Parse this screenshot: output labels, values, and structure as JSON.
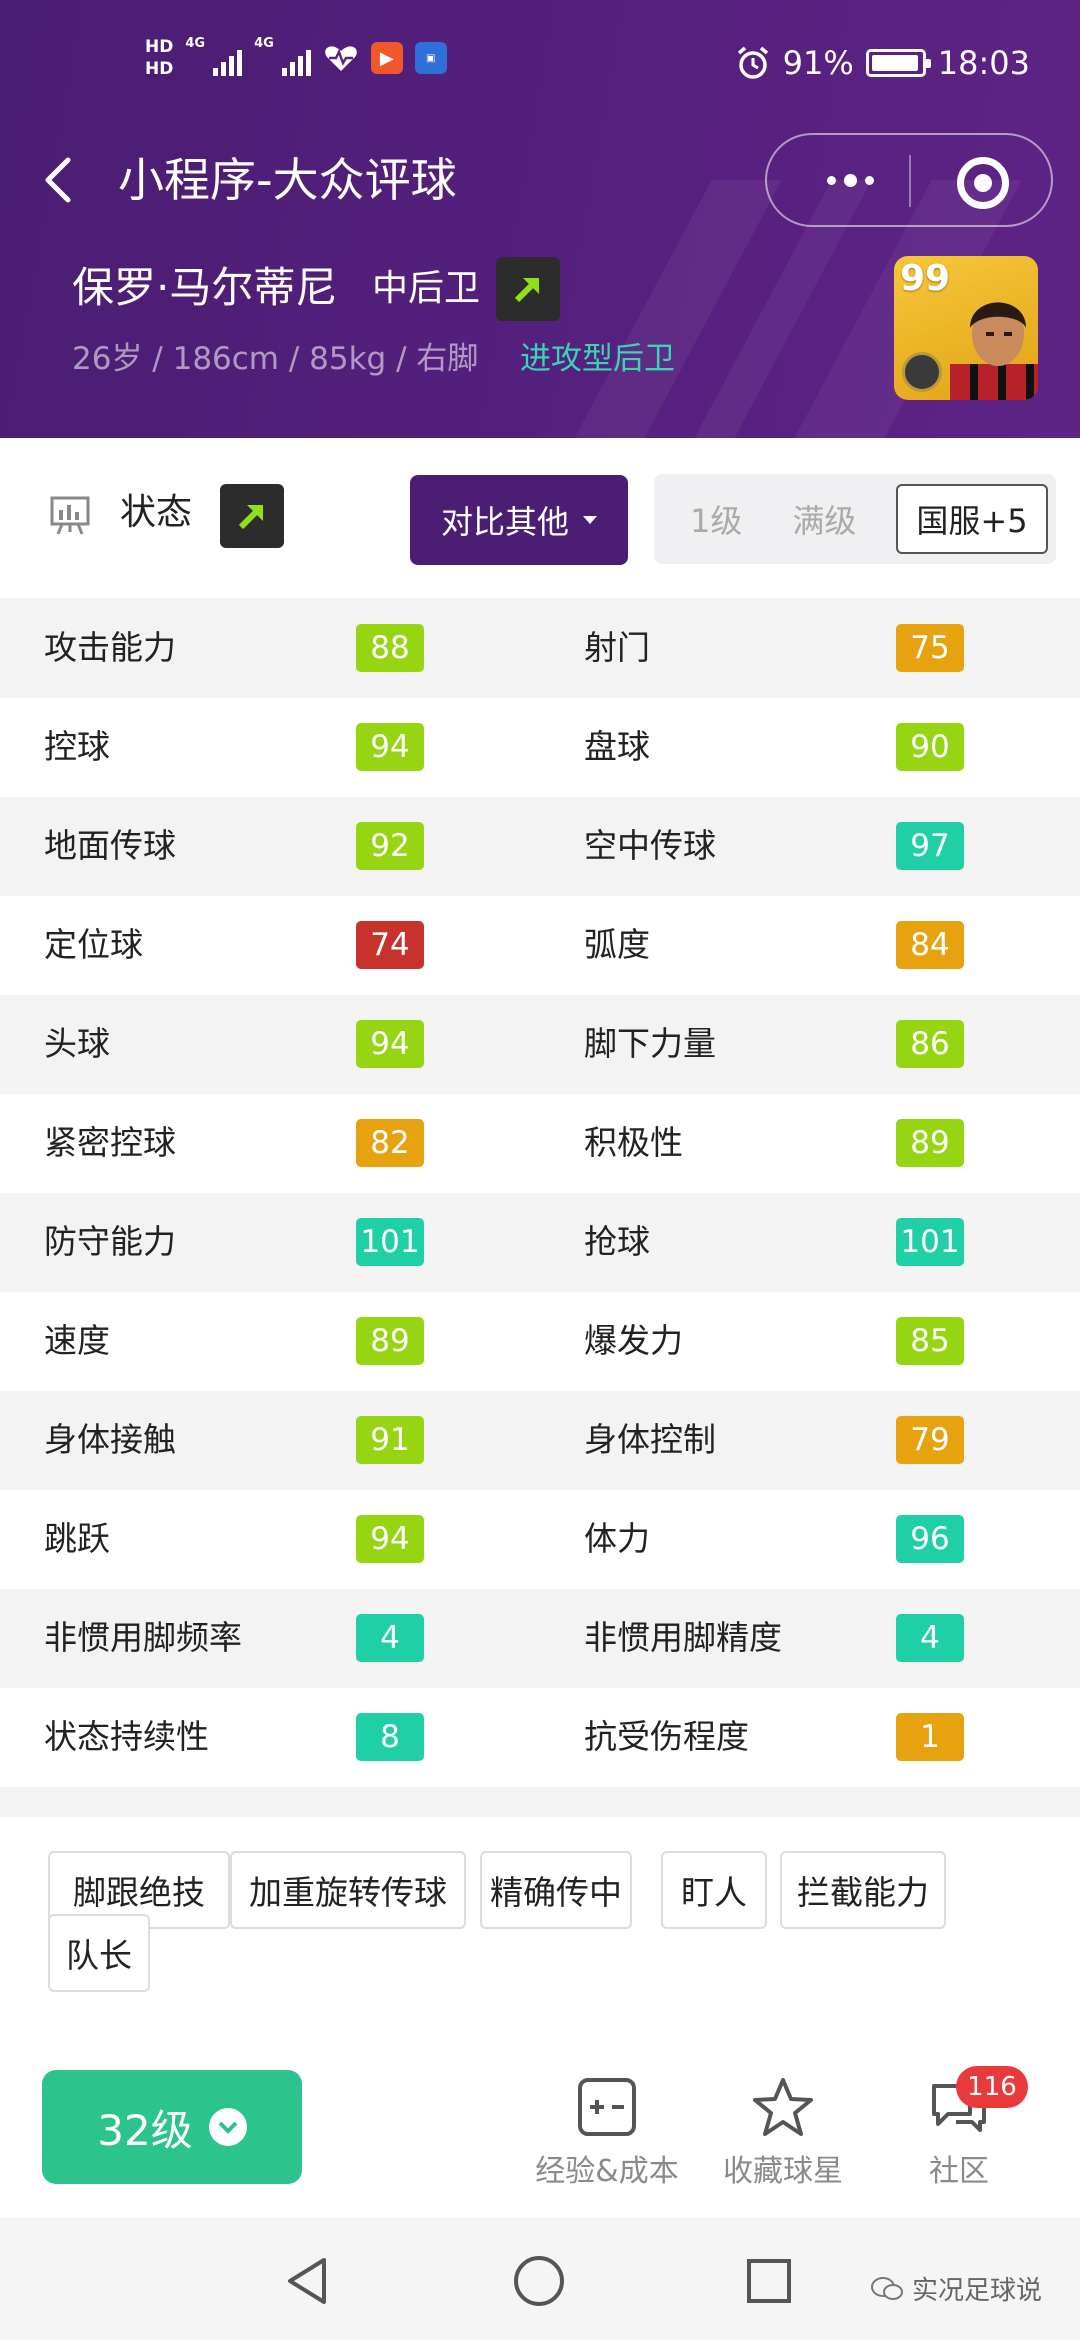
{
  "status_bar": {
    "hd1": "HD",
    "hd2": "HD",
    "net1": "4G",
    "net2": "4G",
    "battery_percent": "91%",
    "time": "18:03"
  },
  "nav": {
    "title": "小程序-大众评球"
  },
  "player": {
    "name": "保罗·马尔蒂尼",
    "position": "中后卫",
    "info": "26岁 / 186cm / 85kg / 右脚",
    "style": "进攻型后卫",
    "rating": "99"
  },
  "tab": {
    "label": "状态",
    "compare_label": "对比其他",
    "levels": [
      "1级",
      "满级"
    ],
    "active_level": "国服+5"
  },
  "stats": [
    {
      "left": {
        "name": "攻击能力",
        "value": "88",
        "color": "#95d512"
      },
      "right": {
        "name": "射门",
        "value": "75",
        "color": "#e7a20f"
      }
    },
    {
      "left": {
        "name": "控球",
        "value": "94",
        "color": "#95d512"
      },
      "right": {
        "name": "盘球",
        "value": "90",
        "color": "#95d512"
      }
    },
    {
      "left": {
        "name": "地面传球",
        "value": "92",
        "color": "#95d512"
      },
      "right": {
        "name": "空中传球",
        "value": "97",
        "color": "#1fcfa6"
      }
    },
    {
      "left": {
        "name": "定位球",
        "value": "74",
        "color": "#c8322c"
      },
      "right": {
        "name": "弧度",
        "value": "84",
        "color": "#e7a20f"
      }
    },
    {
      "left": {
        "name": "头球",
        "value": "94",
        "color": "#95d512"
      },
      "right": {
        "name": "脚下力量",
        "value": "86",
        "color": "#95d512"
      }
    },
    {
      "left": {
        "name": "紧密控球",
        "value": "82",
        "color": "#e7a20f"
      },
      "right": {
        "name": "积极性",
        "value": "89",
        "color": "#95d512"
      }
    },
    {
      "left": {
        "name": "防守能力",
        "value": "101",
        "color": "#1fcfa6"
      },
      "right": {
        "name": "抢球",
        "value": "101",
        "color": "#1fcfa6"
      }
    },
    {
      "left": {
        "name": "速度",
        "value": "89",
        "color": "#95d512"
      },
      "right": {
        "name": "爆发力",
        "value": "85",
        "color": "#95d512"
      }
    },
    {
      "left": {
        "name": "身体接触",
        "value": "91",
        "color": "#95d512"
      },
      "right": {
        "name": "身体控制",
        "value": "79",
        "color": "#e7a20f"
      }
    },
    {
      "left": {
        "name": "跳跃",
        "value": "94",
        "color": "#95d512"
      },
      "right": {
        "name": "体力",
        "value": "96",
        "color": "#1fcfa6"
      }
    },
    {
      "left": {
        "name": "非惯用脚频率",
        "value": "4",
        "color": "#1fcfa6"
      },
      "right": {
        "name": "非惯用脚精度",
        "value": "4",
        "color": "#1fcfa6"
      }
    },
    {
      "left": {
        "name": "状态持续性",
        "value": "8",
        "color": "#1fcfa6"
      },
      "right": {
        "name": "抗受伤程度",
        "value": "1",
        "color": "#e7a20f"
      }
    }
  ],
  "skills": [
    "脚跟绝技",
    "加重旋转传球",
    "精确传中",
    "盯人",
    "拦截能力",
    "队长"
  ],
  "bottom": {
    "level_button": "32级",
    "exp_cost": "经验&成本",
    "favorite": "收藏球星",
    "community": "社区",
    "community_badge": "116"
  },
  "watermark": "实况足球说",
  "colors": {
    "brand_purple": "#4b1e74",
    "green_button": "#2bc48c",
    "style_teal": "#38d4b6"
  }
}
